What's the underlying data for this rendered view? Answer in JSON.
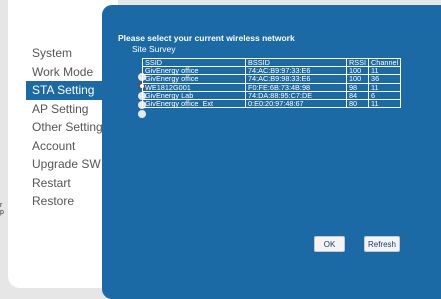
{
  "edge_text": [
    "r",
    "p"
  ],
  "sidebar": {
    "items": [
      {
        "label": "System",
        "active": false
      },
      {
        "label": "Work Mode",
        "active": false
      },
      {
        "label": "STA Setting",
        "active": true
      },
      {
        "label": "AP Setting",
        "active": false
      },
      {
        "label": "Other Setting",
        "active": false
      },
      {
        "label": "Account",
        "active": false
      },
      {
        "label": "Upgrade SW",
        "active": false
      },
      {
        "label": "Restart",
        "active": false
      },
      {
        "label": "Restore",
        "active": false
      }
    ]
  },
  "main": {
    "heading": "Please select your current wireless network",
    "subheading": "Site Survey",
    "columns": [
      "SSID",
      "BSSID",
      "RSSI",
      "Channel"
    ],
    "rows": [
      {
        "ssid": "GivEnergy office",
        "bssid": "74:AC:B9:97:33:E6",
        "rssi": "100",
        "channel": "11",
        "selected": false
      },
      {
        "ssid": "GivEnergy office",
        "bssid": "74:AC:B9:98:33:E6",
        "rssi": "100",
        "channel": "36",
        "selected": true
      },
      {
        "ssid": "WE1812G001",
        "bssid": "F0:FE:6B:73:4B:98",
        "rssi": "98",
        "channel": "11",
        "selected": false
      },
      {
        "ssid": "GivEnergy Lab",
        "bssid": "74:DA:88:95:C7:DE",
        "rssi": "84",
        "channel": "6",
        "selected": false
      },
      {
        "ssid": "GivEnergy office_Ext",
        "bssid": "0:E0:20:97:48:67",
        "rssi": "80",
        "channel": "11",
        "selected": false
      }
    ],
    "ok_label": "OK",
    "refresh_label": "Refresh"
  },
  "colors": {
    "panel": "#1b6aa6",
    "background": "#e6e6e6"
  }
}
